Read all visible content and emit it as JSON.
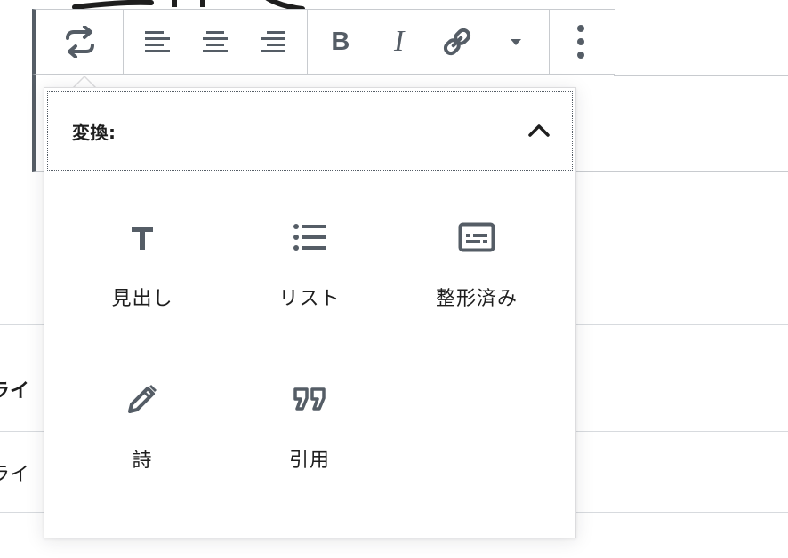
{
  "toolbar": {
    "transform_icon": "transform-arrows-icon",
    "align_left_icon": "align-left-icon",
    "align_center_icon": "align-center-icon",
    "align_right_icon": "align-right-icon",
    "bold_label": "B",
    "italic_label": "I",
    "link_icon": "link-icon",
    "more_formats_icon": "caret-down-icon",
    "more_options_icon": "vertical-ellipsis-icon"
  },
  "transform_panel": {
    "title": "変換:",
    "collapse_icon": "chevron-up-icon",
    "items": [
      {
        "label": "見出し",
        "icon": "heading-t-icon"
      },
      {
        "label": "リスト",
        "icon": "list-icon"
      },
      {
        "label": "整形済み",
        "icon": "preformatted-icon"
      },
      {
        "label": "詩",
        "icon": "pencil-icon"
      },
      {
        "label": "引用",
        "icon": "quote-icon"
      }
    ]
  },
  "background": {
    "row_labels": [
      "ライ",
      "ライ"
    ]
  },
  "colors": {
    "icon": "#555d66",
    "text": "#1e1e1e",
    "border": "#c8cbcf",
    "accent_bar": "#555d66"
  }
}
